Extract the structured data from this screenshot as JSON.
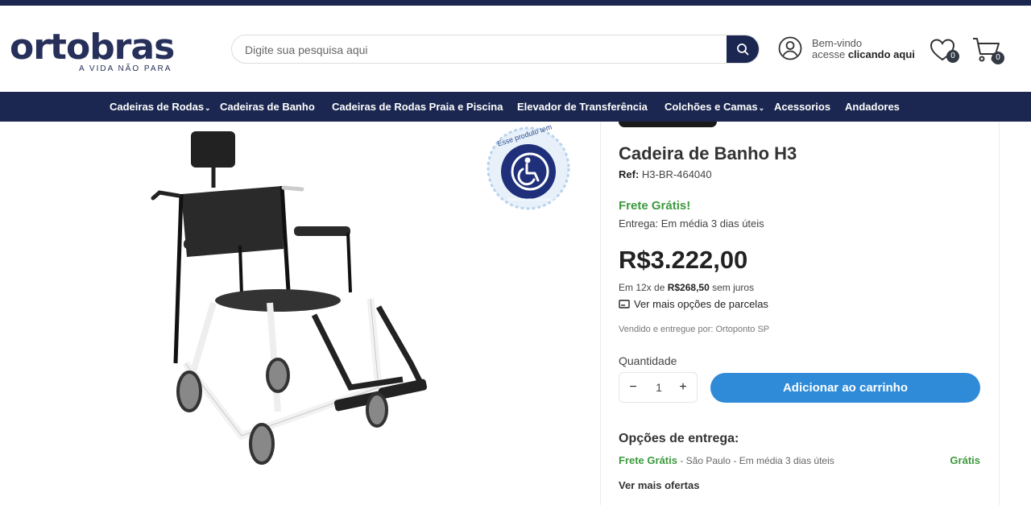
{
  "header": {
    "logo_text": "ortobras",
    "logo_tagline": "A VIDA NÃO PARA",
    "search_placeholder": "Digite sua pesquisa aqui",
    "user_greeting": "Bem-vindo",
    "user_prefix": "acesse ",
    "user_link": "clicando aqui",
    "favorites_count": "0",
    "cart_count": "0"
  },
  "nav": {
    "items": [
      {
        "label": "Cadeiras de Rodas",
        "has_dropdown": true
      },
      {
        "label": "Cadeiras de Banho",
        "has_dropdown": false
      },
      {
        "label": "Cadeiras de Rodas Praia e Piscina",
        "has_dropdown": false
      },
      {
        "label": "Elevador de Transferência",
        "has_dropdown": false
      },
      {
        "label": "Colchões e Camas",
        "has_dropdown": true
      },
      {
        "label": "Acessorios",
        "has_dropdown": false
      },
      {
        "label": "Andadores",
        "has_dropdown": false
      }
    ]
  },
  "gallery": {
    "badge_text": "Esse produto tem",
    "badge_subtext": "CRÉDITOS DE ACESSIBILIDADE"
  },
  "product": {
    "title": "Cadeira de Banho H3",
    "ref_label": "Ref:",
    "ref_value": "H3-BR-464040",
    "shipping_badge": "Frete Grátis!",
    "delivery": "Entrega: Em média 3 dias úteis",
    "price": "R$3.222,00",
    "installment_prefix": "Em 12x de ",
    "installment_value": "R$268,50",
    "installment_suffix": " sem juros",
    "more_installments": "Ver mais opções de parcelas",
    "seller": "Vendido e entregue por: Ortoponto SP",
    "quantity_label": "Quantidade",
    "quantity_value": "1",
    "add_to_cart": "Adicionar ao carrinho"
  },
  "delivery_options": {
    "title": "Opções de entrega:",
    "rows": [
      {
        "method": "Frete Grátis",
        "info": " - São Paulo - Em média 3 dias úteis",
        "price": "Grátis"
      }
    ],
    "more_offers": "Ver mais ofertas"
  },
  "colors": {
    "brand_navy": "#1b2750",
    "accent_blue": "#2f8bd8",
    "success_green": "#3c9a3e"
  }
}
